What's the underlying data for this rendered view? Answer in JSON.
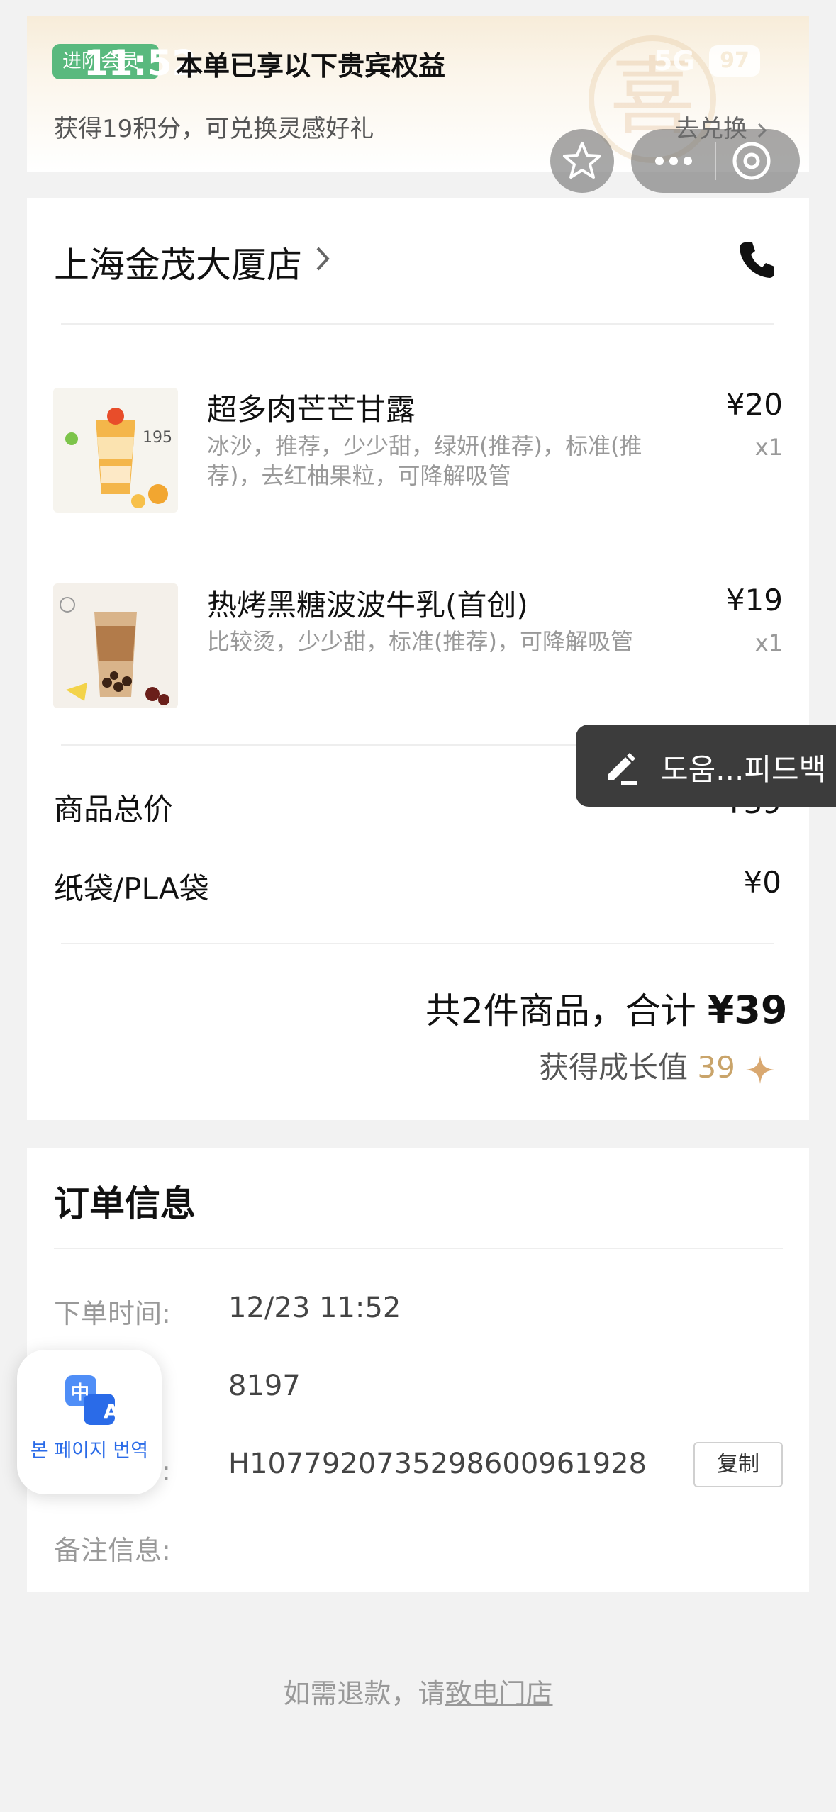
{
  "status_bar": {
    "time": "11:52",
    "network": "5G",
    "battery": "97"
  },
  "banner": {
    "level_chip": "进阶会员",
    "title": "本单已享以下贵宾权益",
    "points_text": "获得19积分，可兑换灵感好礼",
    "redeem_link": "去兑换",
    "seal_char": "喜"
  },
  "store": {
    "name": "上海金茂大厦店"
  },
  "items": [
    {
      "name": "超多肉芒芒甘露",
      "spec": "冰沙，推荐，少少甜，绿妍(推荐)，标准(推荐)，去红柚果粒，可降解吸管",
      "price": "¥20",
      "qty": "x1",
      "thumb_label": "195"
    },
    {
      "name": "热烤黑糖波波牛乳(首创)",
      "spec": "比较烫，少少甜，标准(推荐)，可降解吸管",
      "price": "¥19",
      "qty": "x1"
    }
  ],
  "totals": {
    "goods_label": "商品总价",
    "goods_value": "¥39",
    "bag_label": "纸袋/PLA袋",
    "bag_value": "¥0",
    "summary_prefix": "共2件商品，合计",
    "summary_total": "¥39",
    "growth_label": "获得成长值",
    "growth_value": "39"
  },
  "feedback": {
    "label": "도움...피드백"
  },
  "order_info": {
    "title": "订单信息",
    "time_label": "下单时间:",
    "time_value": "12/23 11:52",
    "pickup_value": "8197",
    "order_no_label_tail": "号:",
    "order_no_value": "H1077920735298600961928",
    "copy_label": "复制",
    "note_label": "备注信息:"
  },
  "translate": {
    "label": "본 페이지 번역",
    "icon_zh": "中",
    "icon_a": "A"
  },
  "footer": {
    "refund_prefix": "如需退款，请",
    "refund_link": "致电门店"
  }
}
